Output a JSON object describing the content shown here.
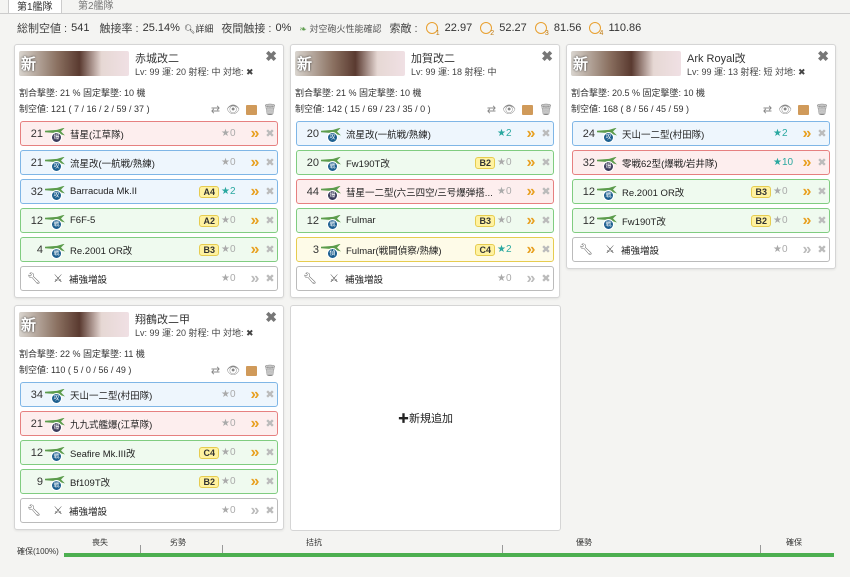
{
  "tabs": [
    "第1艦隊",
    "第2艦隊"
  ],
  "summary": {
    "air_label": "総制空値 :",
    "air_value": "541",
    "contact_label": "触接率 :",
    "contact_value": "25.14%",
    "detail_label": "詳細",
    "night_label": "夜間触接 :",
    "night_value": "0%",
    "aaci_label": "対空砲火性能確認",
    "recon_label": "索敵 :",
    "recon": [
      {
        "n": "1",
        "v": "22.97"
      },
      {
        "n": "2",
        "v": "52.27"
      },
      {
        "n": "3",
        "v": "81.56"
      },
      {
        "n": "4",
        "v": "110.86"
      }
    ]
  },
  "ships": [
    {
      "name": "赤城改二",
      "kai": "新",
      "stats": "Lv: 99  運: 20  射程: 中  対地: ✖",
      "line1": "割合撃墜: 21 %  固定撃墜: 10 機",
      "line2": "制空値: 121 ( 7 / 16 / 2 / 59 / 37 )",
      "slots": [
        {
          "cnt": "21",
          "name": "彗星(江草隊)",
          "prof": "",
          "star": "★0",
          "cls": "red",
          "badge": "爆"
        },
        {
          "cnt": "21",
          "name": "流星改(一航戦/熟練)",
          "prof": "",
          "star": "★0",
          "cls": "blue",
          "badge": "攻"
        },
        {
          "cnt": "32",
          "name": "Barracuda Mk.II",
          "prof": "A4",
          "star": "★2",
          "cls": "blue",
          "badge": "攻"
        },
        {
          "cnt": "12",
          "name": "F6F-5",
          "prof": "A2",
          "star": "★0",
          "cls": "green",
          "badge": "戦"
        },
        {
          "cnt": "4",
          "name": "Re.2001 OR改",
          "prof": "B3",
          "star": "★0",
          "cls": "green",
          "badge": "戦"
        },
        {
          "cnt": "",
          "name": "補強増設",
          "prof": "",
          "star": "★0",
          "cls": "white",
          "badge": ""
        }
      ]
    },
    {
      "name": "加賀改二",
      "kai": "新",
      "stats": "Lv: 99  運: 18  射程: 中",
      "line1": "割合撃墜: 21 %  固定撃墜: 10 機",
      "line2": "制空値: 142 ( 15 / 69 / 23 / 35 / 0 )",
      "slots": [
        {
          "cnt": "20",
          "name": "流星改(一航戦/熟練)",
          "prof": "",
          "star": "★2",
          "cls": "blue",
          "badge": "攻"
        },
        {
          "cnt": "20",
          "name": "Fw190T改",
          "prof": "B2",
          "star": "★0",
          "cls": "green",
          "badge": "戦"
        },
        {
          "cnt": "44",
          "name": "彗星一二型(六三四空/三号爆弾搭...",
          "prof": "",
          "star": "★0",
          "cls": "red",
          "badge": "爆"
        },
        {
          "cnt": "12",
          "name": "Fulmar",
          "prof": "B3",
          "star": "★0",
          "cls": "green",
          "badge": "戦"
        },
        {
          "cnt": "3",
          "name": "Fulmar(戦闘偵察/熟練)",
          "prof": "C4",
          "star": "★2",
          "cls": "yellow",
          "badge": "偵"
        },
        {
          "cnt": "",
          "name": "補強増設",
          "prof": "",
          "star": "★0",
          "cls": "white",
          "badge": ""
        }
      ]
    },
    {
      "name": "Ark Royal改",
      "kai": "新",
      "stats": "Lv: 99  運: 13  射程: 短  対地: ✖",
      "line1": "割合撃墜: 20.5 %  固定撃墜: 10 機",
      "line2": "制空値: 168 ( 8 / 56 / 45 / 59 )",
      "slots": [
        {
          "cnt": "24",
          "name": "天山一二型(村田隊)",
          "prof": "",
          "star": "★2",
          "cls": "blue",
          "badge": "攻"
        },
        {
          "cnt": "32",
          "name": "零戦62型(爆戦/岩井隊)",
          "prof": "",
          "star": "★10",
          "cls": "red",
          "badge": "爆"
        },
        {
          "cnt": "12",
          "name": "Re.2001 OR改",
          "prof": "B3",
          "star": "★0",
          "cls": "green",
          "badge": "戦"
        },
        {
          "cnt": "12",
          "name": "Fw190T改",
          "prof": "B2",
          "star": "★0",
          "cls": "green",
          "badge": "戦"
        },
        {
          "cnt": "",
          "name": "補強増設",
          "prof": "",
          "star": "★0",
          "cls": "white",
          "badge": ""
        }
      ]
    },
    {
      "name": "翔鶴改二甲",
      "kai": "新",
      "stats": "Lv: 99  運: 20  射程: 中  対地: ✖",
      "line1": "割合撃墜: 22 %  固定撃墜: 11 機",
      "line2": "制空値: 110 ( 5 / 0 / 56 / 49 )",
      "slots": [
        {
          "cnt": "34",
          "name": "天山一二型(村田隊)",
          "prof": "",
          "star": "★0",
          "cls": "blue",
          "badge": "攻"
        },
        {
          "cnt": "21",
          "name": "九九式艦爆(江草隊)",
          "prof": "",
          "star": "★0",
          "cls": "red",
          "badge": "爆"
        },
        {
          "cnt": "12",
          "name": "Seafire Mk.III改",
          "prof": "C4",
          "star": "★0",
          "cls": "green",
          "badge": "戦"
        },
        {
          "cnt": "9",
          "name": "Bf109T改",
          "prof": "B2",
          "star": "★0",
          "cls": "green",
          "badge": "戦"
        },
        {
          "cnt": "",
          "name": "補強増設",
          "prof": "",
          "star": "★0",
          "cls": "white",
          "badge": ""
        }
      ]
    }
  ],
  "add_label": "✚新規追加",
  "airbar": {
    "kakuho": "確保(100%)",
    "labels": [
      "喪失",
      "劣勢",
      "拮抗",
      "優勢",
      "確保"
    ]
  },
  "colors": {
    "green": "#4caf50",
    "chevron": "#e8a020",
    "teal": "#2aa8a0"
  }
}
